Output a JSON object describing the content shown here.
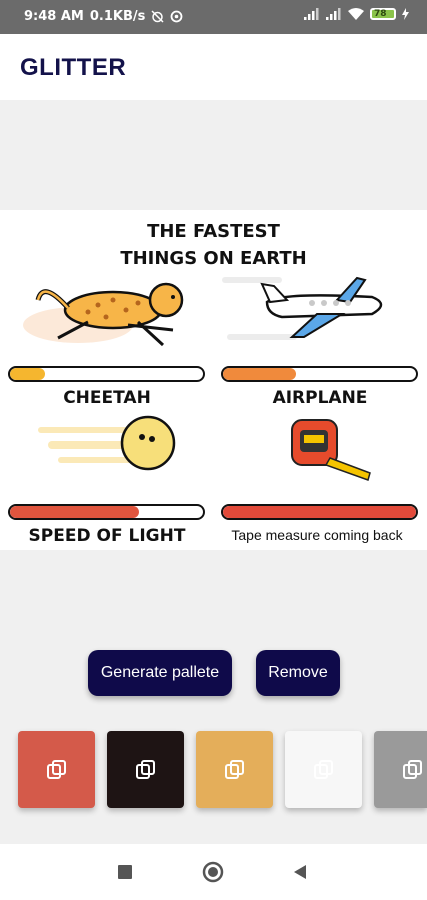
{
  "status_bar": {
    "time": "9:48 AM",
    "network_speed": "0.1KB/s",
    "battery_level": "78"
  },
  "app": {
    "title": "GLITTER"
  },
  "infographic": {
    "heading_line1": "THE FASTEST",
    "heading_line2": "THINGS ON EARTH",
    "items": [
      {
        "label": "CHEETAH",
        "progress": 0.18,
        "fill_color": "#f5b62f"
      },
      {
        "label": "AIRPLANE",
        "progress": 0.38,
        "fill_color": "#f08a3c"
      },
      {
        "label": "SPEED OF LIGHT",
        "progress": 0.67,
        "fill_color": "#e0553e"
      },
      {
        "label": "Tape measure coming back",
        "progress": 1.0,
        "fill_color": "#e24a3a"
      }
    ]
  },
  "actions": {
    "generate_label": "Generate pallete",
    "remove_label": "Remove"
  },
  "palette": [
    {
      "color": "#d45a4a",
      "icon": "copy-icon",
      "icon_color": "#ffffff"
    },
    {
      "color": "#1e1414",
      "icon": "copy-icon",
      "icon_color": "#ffffff"
    },
    {
      "color": "#e4ae5a",
      "icon": "copy-icon",
      "icon_color": "#ffffff"
    },
    {
      "color": "#f7f7f7",
      "icon": "copy-icon",
      "icon_color": "#ffffff"
    },
    {
      "color": "#9a9a9a",
      "icon": "copy-icon",
      "icon_color": "#ffffff"
    }
  ],
  "colors": {
    "primary": "#0f0a4a",
    "background": "#f0f0f0"
  }
}
